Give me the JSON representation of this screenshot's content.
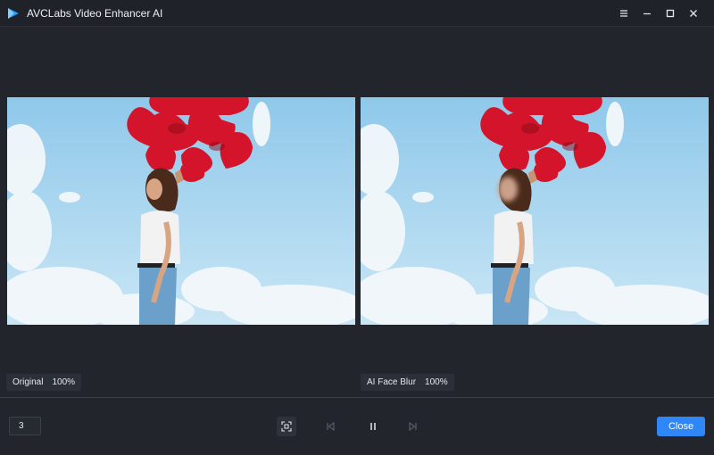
{
  "window": {
    "title": "AVCLabs Video Enhancer AI",
    "icons": [
      "logo-icon",
      "menu-icon",
      "minimize-icon",
      "maximize-icon",
      "close-icon"
    ]
  },
  "preview": {
    "left": {
      "label": "Original",
      "zoom": "100%"
    },
    "right": {
      "label": "AI Face Blur",
      "zoom": "100%"
    }
  },
  "playback": {
    "frame_value": "3",
    "controls": [
      "fit-screen-icon",
      "previous-frame-icon",
      "pause-icon",
      "next-frame-icon"
    ],
    "close_label": "Close"
  },
  "colors": {
    "background": "#22252c",
    "accent": "#2f86f6",
    "sky": "#9fd0ec",
    "balloons": "#d3142a"
  }
}
